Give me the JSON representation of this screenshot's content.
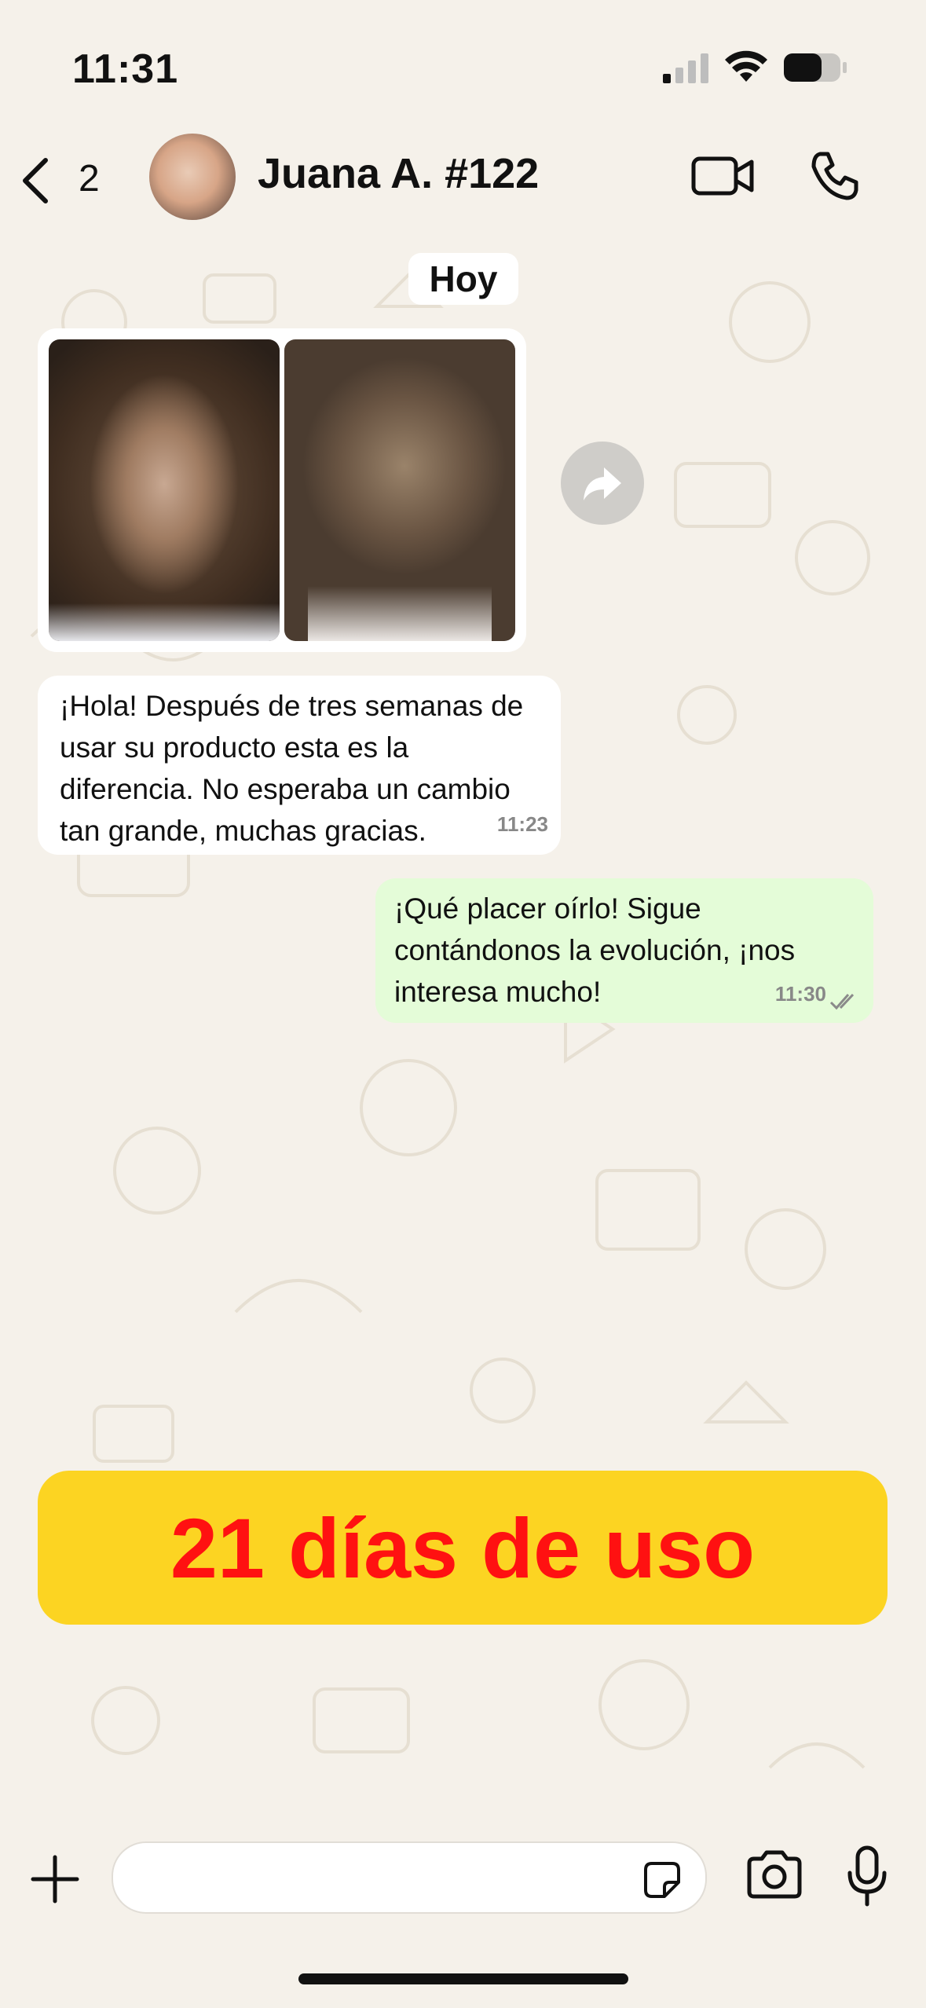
{
  "status_bar": {
    "time": "11:31"
  },
  "header": {
    "back_count": "2",
    "contact_name": "Juana A. #122"
  },
  "chat": {
    "day_label": "Hoy",
    "messages": [
      {
        "direction": "incoming",
        "type": "image"
      },
      {
        "direction": "incoming",
        "text": "¡Hola! Después de tres semanas de usar su producto esta es la diferencia. No esperaba un cambio tan grande, muchas gracias.",
        "time": "11:23"
      },
      {
        "direction": "outgoing",
        "text": "¡Qué placer oírlo! Sigue contándonos la evolución, ¡nos interesa mucho!",
        "time": "11:30",
        "status": "read"
      }
    ]
  },
  "promo": {
    "label": "21 días de uso",
    "background": "#fcd422",
    "color": "#ff1111"
  },
  "composer": {
    "placeholder": ""
  },
  "colors": {
    "outgoing_bubble": "#e4fcd8",
    "incoming_bubble": "#ffffff",
    "background": "#f5f1ea"
  }
}
